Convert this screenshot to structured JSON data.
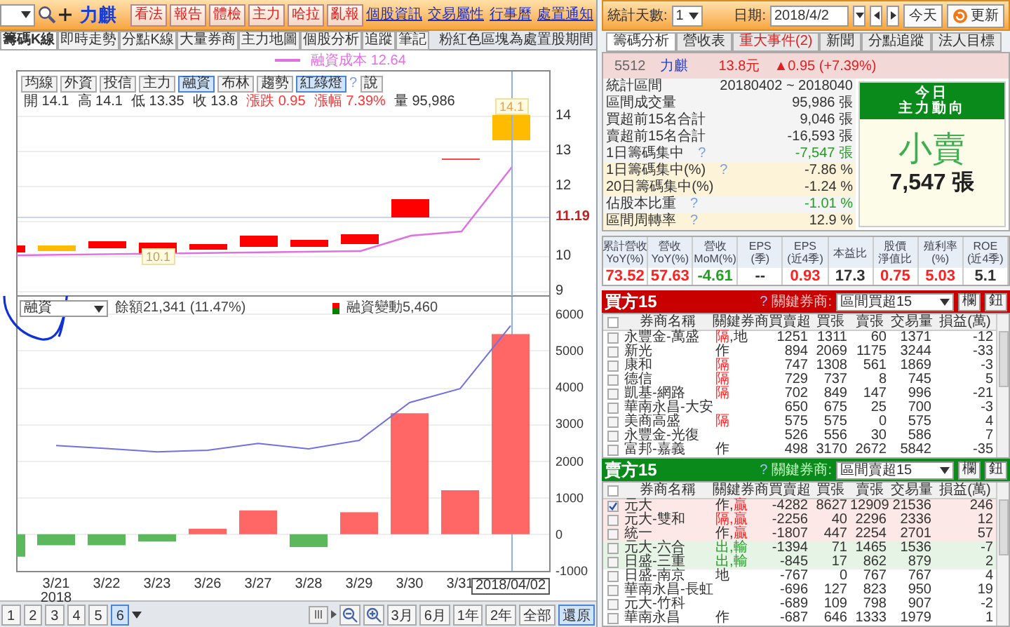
{
  "left": {
    "toolbar": {
      "symbol_name": "力麒",
      "buttons": [
        "看法",
        "報告",
        "體檢",
        "主力",
        "哈拉",
        "亂報"
      ],
      "links": [
        "個股資訊",
        "交易屬性",
        "行事曆",
        "處置通知"
      ]
    },
    "tabs": [
      {
        "label": "籌碼K線",
        "selected": true
      },
      {
        "label": "即時走勢",
        "selected": false
      },
      {
        "label": "分點K線",
        "selected": false
      },
      {
        "label": "大量券商",
        "selected": false
      },
      {
        "label": "主力地圖",
        "selected": false
      },
      {
        "label": "個股分析",
        "selected": false
      },
      {
        "label": "追蹤",
        "selected": false
      },
      {
        "label": "筆記",
        "selected": false
      }
    ],
    "tab_note": "粉紅色區塊為處置股期間",
    "legend": "融資成本 12.64",
    "indicator_buttons": [
      {
        "label": "均線",
        "selected": false
      },
      {
        "label": "外資",
        "selected": false
      },
      {
        "label": "投信",
        "selected": false
      },
      {
        "label": "主力",
        "selected": false
      },
      {
        "label": "融資",
        "selected": true
      },
      {
        "label": "布林",
        "selected": false
      },
      {
        "label": "趨勢",
        "selected": false
      },
      {
        "label": "紅綠燈",
        "selected": true
      }
    ],
    "help": "?",
    "say_button": "說",
    "ohlc": [
      {
        "label": "開",
        "value": "14.1",
        "color": "#333333"
      },
      {
        "label": "高",
        "value": "14.1",
        "color": "#333333"
      },
      {
        "label": "低",
        "value": "13.35",
        "color": "#333333"
      },
      {
        "label": "收",
        "value": "13.8",
        "color": "#333333"
      },
      {
        "label": "漲跌",
        "value": "0.95",
        "color": "#ff3333"
      },
      {
        "label": "漲幅",
        "value": "7.39%",
        "color": "#ff3333"
      },
      {
        "label": "量",
        "value": "95,986",
        "color": "#333333"
      }
    ],
    "price_axis": [
      {
        "text": "14",
        "kind": "tick"
      },
      {
        "text": "13",
        "kind": "tick"
      },
      {
        "text": "12",
        "kind": "tick"
      },
      {
        "text": "11.19",
        "kind": "current"
      },
      {
        "text": "10",
        "kind": "tick"
      },
      {
        "text": "9",
        "kind": "tick"
      }
    ],
    "high_marker": "14.1",
    "low_marker": "10.1",
    "lower_select": "融資",
    "balance_value": "21,341 (11.47%)",
    "change_value": "5,460",
    "chart_data": {
      "type": "bar",
      "stacked": false,
      "categories": [
        "3/21",
        "3/22",
        "3/23",
        "3/26",
        "3/27",
        "3/28",
        "3/29",
        "3/30",
        "3/31",
        "2018/04/02"
      ],
      "series": [
        {
          "name": "融資變動",
          "type": "bar",
          "color": "#ff6666",
          "values": [
            null,
            null,
            null,
            150,
            650,
            null,
            600,
            3300,
            1200,
            5460
          ]
        },
        {
          "type": "bar",
          "color": "#5cb85c",
          "values": [
            -300,
            -300,
            -200,
            null,
            null,
            -350,
            null,
            null,
            null,
            null
          ]
        },
        {
          "name": "餘額",
          "type": "line",
          "color": "#7070e0",
          "values": [
            2420,
            2340,
            2250,
            2290,
            2480,
            2330,
            2560,
            3590,
            3970,
            5690
          ]
        }
      ],
      "yticks": [
        {
          "value": 6000,
          "label": "6000"
        },
        {
          "value": 5000,
          "label": "5000"
        },
        {
          "value": 4000,
          "label": "4000"
        },
        {
          "value": 3000,
          "label": "3000"
        },
        {
          "value": 2000,
          "label": "2000"
        },
        {
          "value": 1000,
          "label": "1000"
        },
        {
          "value": 0,
          "label": "0"
        },
        {
          "value": -1000,
          "label": "-1000"
        }
      ],
      "ylim": [
        -1000,
        6500
      ]
    },
    "year_label": "2018",
    "pages": [
      {
        "label": "1",
        "selected": false
      },
      {
        "label": "2",
        "selected": false
      },
      {
        "label": "3",
        "selected": false
      },
      {
        "label": "4",
        "selected": false
      },
      {
        "label": "5",
        "selected": false
      },
      {
        "label": "6",
        "selected": true
      }
    ],
    "range_buttons": [
      {
        "label": "3月",
        "selected": false
      },
      {
        "label": "6月",
        "selected": false
      },
      {
        "label": "1年",
        "selected": false
      },
      {
        "label": "2年",
        "selected": false
      },
      {
        "label": "全部",
        "selected": false
      },
      {
        "label": "還原",
        "selected": true
      }
    ]
  },
  "right": {
    "days_label": "統計天數:",
    "days_value": "1",
    "date_label": "日期:",
    "date_value": "2018/4/2",
    "today_button": "今天",
    "refresh_button": "更新",
    "tabs": [
      {
        "label": "籌碼分析",
        "selected": true,
        "kind": "normal"
      },
      {
        "label": "營收表",
        "selected": false,
        "kind": "normal"
      },
      {
        "label": "重大事件(2)",
        "selected": false,
        "kind": "alert"
      },
      {
        "label": "新聞",
        "selected": false,
        "kind": "normal"
      },
      {
        "label": "分點追蹤",
        "selected": false,
        "kind": "normal"
      },
      {
        "label": "法人目標",
        "selected": false,
        "kind": "normal"
      }
    ],
    "quote": {
      "code": "5512",
      "name": "力麒",
      "price": "13.8元",
      "change": "▲0.95 (+7.39%)"
    },
    "stats": [
      {
        "label": "統計區間",
        "value": "20180402 ~ 2018040",
        "color": "#333333",
        "highlight": false
      },
      {
        "label": "區間成交量",
        "value": "95,986 張",
        "color": "#333333",
        "highlight": false
      },
      {
        "label": "買超前15名合計",
        "value": "9,046 張",
        "color": "#333333",
        "highlight": false
      },
      {
        "label": "賣超前15名合計",
        "value": "-16,593 張",
        "color": "#333333",
        "highlight": false
      },
      {
        "label": "1日籌碼集中",
        "help": "?",
        "value": "-7,547 張",
        "color": "#22a022",
        "highlight": false
      },
      {
        "label": "1日籌碼集中(%)",
        "help": "?",
        "value": "-7.86 %",
        "color": "#333333",
        "highlight": true
      },
      {
        "label": "20日籌碼集中(%)",
        "value": "-1.24 %",
        "color": "#333333",
        "highlight": true
      },
      {
        "label": "佔股本比重",
        "help": "?",
        "value": "-1.01 %",
        "color": "#22a022",
        "highlight": false
      },
      {
        "label": "區間周轉率",
        "help": "?",
        "value": "12.9 %",
        "color": "#333333",
        "highlight": true
      }
    ],
    "today": {
      "title": [
        "今日",
        "主力動向"
      ],
      "action": "小賣",
      "amount": "7,547 張"
    },
    "metrics": [
      {
        "label": [
          "累計營收",
          "YoY(%)"
        ],
        "value": "73.52",
        "color": "#ff2020"
      },
      {
        "label": [
          "營收",
          "YoY(%)"
        ],
        "value": "57.63",
        "color": "#ff2020"
      },
      {
        "label": [
          "營收",
          "MoM(%)"
        ],
        "value": "-4.61",
        "color": "#22a022"
      },
      {
        "label": [
          "EPS",
          "(季)"
        ],
        "value": "--",
        "color": "#333333"
      },
      {
        "label": [
          "EPS",
          "(近4季)"
        ],
        "value": "0.93",
        "color": "#ff2020"
      },
      {
        "label": [
          "本益比"
        ],
        "value": "17.3",
        "color": "#333333"
      },
      {
        "label": [
          "股價",
          "淨值比"
        ],
        "value": "0.75",
        "color": "#ff2020"
      },
      {
        "label": [
          "殖利率",
          "(%)"
        ],
        "value": "5.03",
        "color": "#ff2020"
      },
      {
        "label": [
          "ROE",
          "(近4季)"
        ],
        "value": "5.1",
        "color": "#333333"
      }
    ],
    "tables": [
      {
        "title": "買方15",
        "kind": "buy",
        "help": "?",
        "filter_label": "關鍵券商:",
        "filter_value": "區間買超15",
        "buttons": [
          "欄",
          "鈕"
        ],
        "all_checked": false,
        "columns": [
          "券商名稱",
          "關鍵券商",
          "買賣超",
          "買張",
          "賣張",
          "交易量",
          "損益(萬)"
        ],
        "rows": [
          {
            "checked": false,
            "kind": "plain",
            "cells": [
              "永豐金-萬盛",
              {
                "segments": [
                  {
                    "text": "隔",
                    "color": "#ff2020"
                  },
                  {
                    "text": ",地",
                    "color": "#333333"
                  }
                ]
              },
              "1251",
              "1311",
              "60",
              "1371",
              "-12"
            ]
          },
          {
            "checked": false,
            "kind": "plain",
            "cells": [
              "新光",
              {
                "segments": [
                  {
                    "text": "作",
                    "color": "#333333"
                  }
                ]
              },
              "894",
              "2069",
              "1175",
              "3244",
              "-33"
            ]
          },
          {
            "checked": false,
            "kind": "plain",
            "cells": [
              "康和",
              {
                "segments": [
                  {
                    "text": "隔",
                    "color": "#ff2020"
                  }
                ]
              },
              "747",
              "1308",
              "561",
              "1869",
              "-3"
            ]
          },
          {
            "checked": false,
            "kind": "plain",
            "cells": [
              "德信",
              {
                "segments": [
                  {
                    "text": "隔",
                    "color": "#ff2020"
                  }
                ]
              },
              "729",
              "737",
              "8",
              "745",
              "5"
            ]
          },
          {
            "checked": false,
            "kind": "plain",
            "cells": [
              "凱基-網路",
              {
                "segments": [
                  {
                    "text": "隔",
                    "color": "#ff2020"
                  }
                ]
              },
              "702",
              "849",
              "147",
              "996",
              "-21"
            ]
          },
          {
            "checked": false,
            "kind": "plain",
            "cells": [
              "華南永昌-大安",
              "",
              "650",
              "675",
              "25",
              "700",
              "-3"
            ]
          },
          {
            "checked": false,
            "kind": "plain",
            "cells": [
              "美商高盛",
              {
                "segments": [
                  {
                    "text": "隔",
                    "color": "#ff2020"
                  }
                ]
              },
              "575",
              "575",
              "0",
              "575",
              "4"
            ]
          },
          {
            "checked": false,
            "kind": "plain",
            "cells": [
              "永豐金-光復",
              "",
              "526",
              "556",
              "30",
              "586",
              "7"
            ]
          },
          {
            "checked": false,
            "kind": "plain",
            "cells": [
              "富邦-嘉義",
              {
                "segments": [
                  {
                    "text": "作",
                    "color": "#333333"
                  }
                ]
              },
              "498",
              "3170",
              "2672",
              "5842",
              "-35"
            ]
          }
        ]
      },
      {
        "title": "賣方15",
        "kind": "sell",
        "help": "?",
        "filter_label": "關鍵券商:",
        "filter_value": "區間賣超15",
        "buttons": [
          "欄",
          "鈕"
        ],
        "all_checked": false,
        "columns": [
          "券商名稱",
          "關鍵券商",
          "買賣超",
          "買張",
          "賣張",
          "交易量",
          "損益(萬)"
        ],
        "rows": [
          {
            "checked": true,
            "kind": "gain",
            "cells": [
              "元大",
              {
                "segments": [
                  {
                    "text": "作,",
                    "color": "#333333"
                  },
                  {
                    "text": "贏",
                    "color": "#ff2020"
                  }
                ]
              },
              "-4282",
              "8627",
              "12909",
              "21536",
              "246"
            ]
          },
          {
            "checked": false,
            "kind": "gain",
            "cells": [
              "元大-雙和",
              {
                "segments": [
                  {
                    "text": "隔,贏",
                    "color": "#ff2020"
                  }
                ]
              },
              "-2256",
              "40",
              "2296",
              "2336",
              "12"
            ]
          },
          {
            "checked": false,
            "kind": "gain",
            "cells": [
              "統一",
              {
                "segments": [
                  {
                    "text": "作,",
                    "color": "#333333"
                  },
                  {
                    "text": "贏",
                    "color": "#ff2020"
                  }
                ]
              },
              "-1807",
              "447",
              "2254",
              "2701",
              "57"
            ]
          },
          {
            "checked": false,
            "kind": "loss",
            "cells": [
              "元大-六合",
              {
                "segments": [
                  {
                    "text": "出,輸",
                    "color": "#22a022"
                  }
                ]
              },
              "-1394",
              "71",
              "1465",
              "1536",
              "-7"
            ]
          },
          {
            "checked": false,
            "kind": "loss",
            "cells": [
              "日盛-三重",
              {
                "segments": [
                  {
                    "text": "出,輸",
                    "color": "#22a022"
                  }
                ]
              },
              "-845",
              "17",
              "862",
              "879",
              "2"
            ]
          },
          {
            "checked": false,
            "kind": "plain",
            "cells": [
              "日盛-南京",
              {
                "segments": [
                  {
                    "text": "地",
                    "color": "#333333"
                  }
                ]
              },
              "-767",
              "0",
              "767",
              "767",
              "4"
            ]
          },
          {
            "checked": false,
            "kind": "plain",
            "cells": [
              "華南永昌-長虹",
              "",
              "-696",
              "127",
              "823",
              "950",
              "19"
            ]
          },
          {
            "checked": false,
            "kind": "plain",
            "cells": [
              "元大-竹科",
              "",
              "-689",
              "109",
              "798",
              "907",
              "-2"
            ]
          },
          {
            "checked": false,
            "kind": "plain",
            "cells": [
              "華南永昌",
              {
                "segments": [
                  {
                    "text": "作",
                    "color": "#333333"
                  }
                ]
              },
              "-687",
              "646",
              "1333",
              "1979",
              "1"
            ]
          }
        ]
      }
    ]
  }
}
